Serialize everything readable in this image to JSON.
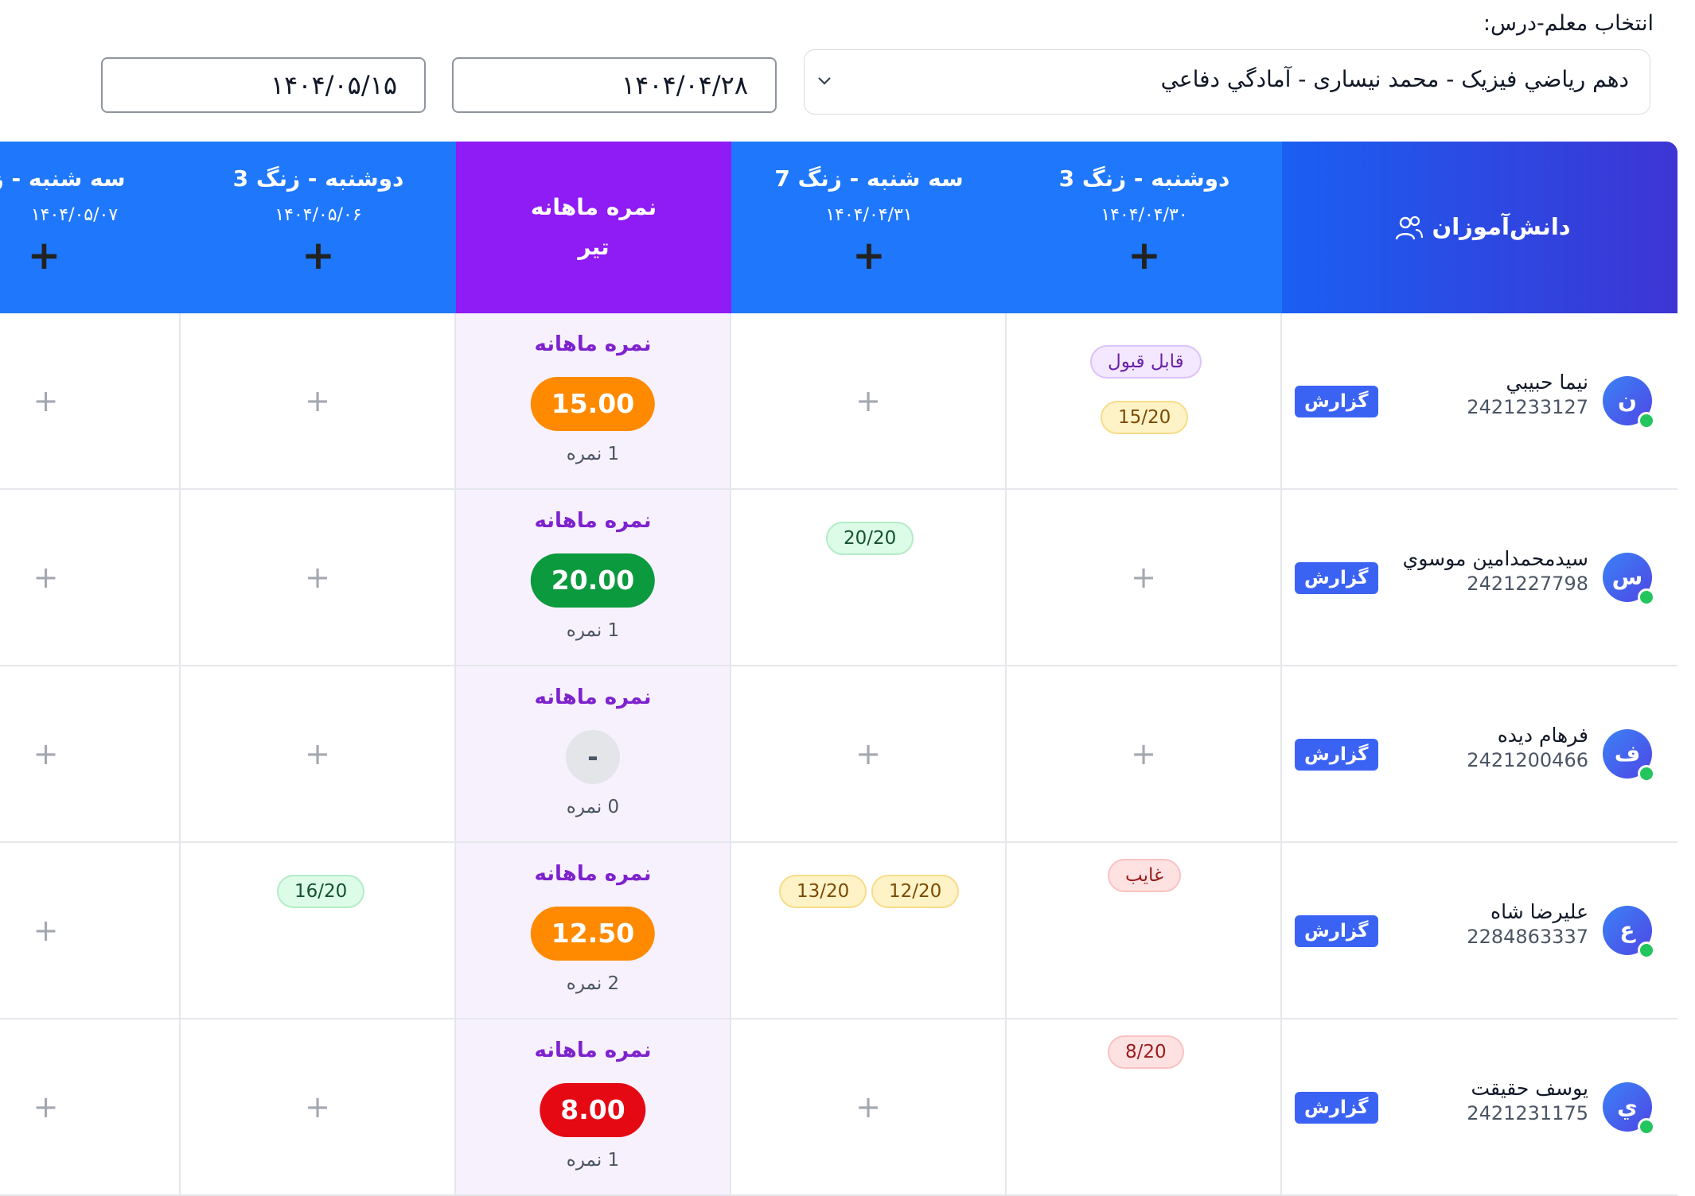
{
  "filter": {
    "label": "انتخاب معلم-درس:",
    "course_value": "دهم رياضي فيزيک - محمد نيساری - آمادگي دفاعي",
    "date_from": "۱۴۰۴/۰۴/۲۸",
    "date_to": "۱۴۰۴/۰۵/۱۵"
  },
  "colors": {
    "header_blue": "#1f78fb",
    "header_monthly": "#8f1bf5",
    "grade_orange": "#ff8a00",
    "grade_green": "#0b9a3e",
    "grade_red": "#e50914"
  },
  "header": {
    "students_label": "دانش‌آموزان",
    "students_icon": "users-icon",
    "session1_title": "دوشنبه - زنگ 3",
    "session1_date": "۱۴۰۴/۰۴/۳۰",
    "session2_title": "سه شنبه - زنگ 7",
    "session2_date": "۱۴۰۴/۰۴/۳۱",
    "monthly_title": "نمره ماهانه",
    "monthly_month": "تير",
    "session3_title": "دوشنبه - زنگ 3",
    "session3_date": "۱۴۰۴/۰۵/۰۶",
    "session4_title": "سه شنبه - زنگ",
    "session4_date": "۱۴۰۴/۰۵/۰۷",
    "add_symbol": "+"
  },
  "report_label": "گزارش",
  "monthly_label": "نمره ماهانه",
  "students": [
    {
      "initial": "ن",
      "name": "نيما حبيبي",
      "id": "2421233127",
      "monthly": "15.00",
      "monthly_color": "#ff8a00",
      "count": "1 نمره",
      "s1_status": "قابل قبول",
      "s1_grade": "15/20"
    },
    {
      "initial": "س",
      "name": "سيدمحمدامين موسوي",
      "id": "2421227798",
      "monthly": "20.00",
      "monthly_color": "#0b9a3e",
      "count": "1 نمره",
      "s2_grade": "20/20"
    },
    {
      "initial": "ف",
      "name": "فرهام ديده",
      "id": "2421200466",
      "monthly": "-",
      "count": "0 نمره"
    },
    {
      "initial": "ع",
      "name": "عليرضا شاه",
      "id": "2284863337",
      "monthly": "12.50",
      "monthly_color": "#ff8a00",
      "count": "2 نمره",
      "s1_status": "غايب",
      "s2_grade_a": "12/20",
      "s2_grade_b": "13/20",
      "s3_grade": "16/20"
    },
    {
      "initial": "ي",
      "name": "يوسف حقيقت",
      "id": "2421231175",
      "monthly": "8.00",
      "monthly_color": "#e50914",
      "count": "1 نمره",
      "s1_grade": "8/20"
    }
  ]
}
